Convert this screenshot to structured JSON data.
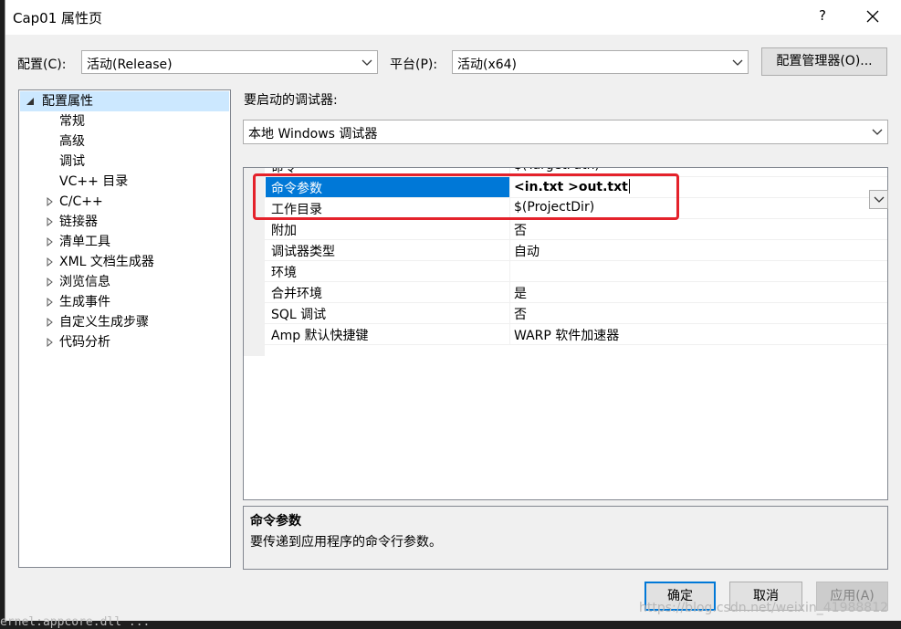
{
  "window": {
    "title": "Cap01 属性页",
    "help_label": "?"
  },
  "config": {
    "label": "配置(C):",
    "value": "活动(Release)"
  },
  "platform": {
    "label": "平台(P):",
    "value": "活动(x64)"
  },
  "config_manager_label": "配置管理器(O)...",
  "tree": {
    "root": "配置属性",
    "children": [
      "常规",
      "高级",
      "调试",
      "VC++ 目录"
    ],
    "groups": [
      "C/C++",
      "链接器",
      "清单工具",
      "XML 文档生成器",
      "浏览信息",
      "生成事件",
      "自定义生成步骤",
      "代码分析"
    ]
  },
  "debugger": {
    "label": "要启动的调试器:",
    "value": "本地 Windows 调试器"
  },
  "properties": [
    {
      "name": "命令",
      "value": "$(TargetPath)"
    },
    {
      "name": "命令参数",
      "value": "<in.txt >out.txt"
    },
    {
      "name": "工作目录",
      "value": "$(ProjectDir)"
    },
    {
      "name": "附加",
      "value": "否"
    },
    {
      "name": "调试器类型",
      "value": "自动"
    },
    {
      "name": "环境",
      "value": ""
    },
    {
      "name": "合并环境",
      "value": "是"
    },
    {
      "name": "SQL 调试",
      "value": "否"
    },
    {
      "name": "Amp 默认快捷键",
      "value": "WARP 软件加速器"
    }
  ],
  "description": {
    "title": "命令参数",
    "text": "要传递到应用程序的命令行参数。"
  },
  "buttons": {
    "ok": "确定",
    "cancel": "取消",
    "apply": "应用(A)"
  },
  "watermark": "https://blog.csdn.net/weixin_41988812",
  "background_text": "ernel:appcore.dll  ...",
  "colors": {
    "selection": "#0078d7",
    "tree_selection": "#cce8ff",
    "annotation": "#e4222b"
  }
}
